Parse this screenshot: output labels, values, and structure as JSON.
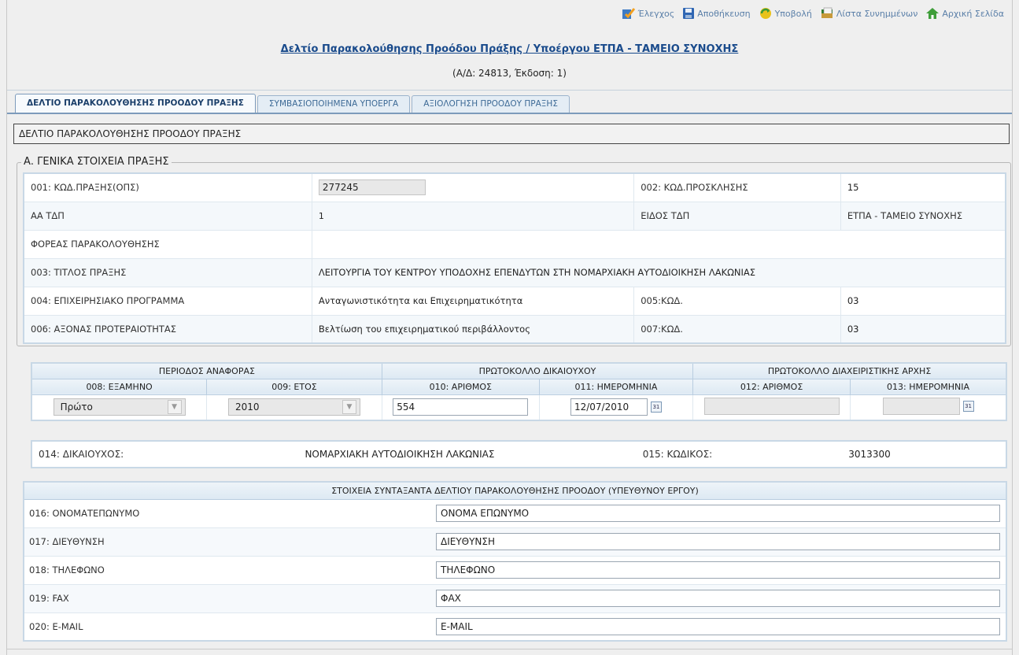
{
  "toolbar": {
    "items": [
      {
        "label": "Έλεγχος",
        "icon": "check-icon"
      },
      {
        "label": "Αποθήκευση",
        "icon": "save-icon"
      },
      {
        "label": "Υποβολή",
        "icon": "submit-icon"
      },
      {
        "label": "Λίστα Συνημμένων",
        "icon": "attachments-icon"
      },
      {
        "label": "Αρχική Σελίδα",
        "icon": "home-icon"
      }
    ]
  },
  "header": {
    "title": "Δελτίο Παρακολούθησης Προόδου Πράξης / Υποέργου ΕΤΠΑ - ΤΑΜΕΙΟ ΣΥΝΟΧΗΣ",
    "subtitle": "(Α/Δ: 24813, Έκδοση: 1)"
  },
  "tabs": [
    {
      "label": "ΔΕΛΤΙΟ ΠΑΡΑΚΟΛΟΥΘΗΣΗΣ ΠΡΟΟΔΟΥ ΠΡΑΞΗΣ",
      "active": true
    },
    {
      "label": "ΣΥΜΒΑΣΙΟΠΟΙΗΜΕΝΑ ΥΠΟΕΡΓΑ",
      "active": false
    },
    {
      "label": "ΑΞΙΟΛΟΓΗΣΗ ΠΡΟΟΔΟΥ ΠΡΑΞΗΣ",
      "active": false
    }
  ],
  "section_banner": "ΔΕΛΤΙΟ ΠΑΡΑΚΟΛΟΥΘΗΣΗΣ ΠΡΟΟΔΟΥ ΠΡΑΞΗΣ",
  "general": {
    "legend": "Α. ΓΕΝΙΚΑ ΣΤΟΙΧΕΙΑ ΠΡΑΞΗΣ",
    "code_label": "001: ΚΩΔ.ΠΡΑΞΗΣ(ΟΠΣ)",
    "code_value": "277245",
    "call_code_label": "002: ΚΩΔ.ΠΡΟΣΚΛΗΣΗΣ",
    "call_code_value": "15",
    "aa_tdp_label": "ΑΑ ΤΔΠ",
    "aa_tdp_value": "1",
    "tdp_type_label": "ΕΙΔΟΣ ΤΔΠ",
    "tdp_type_value": "ΕΤΠΑ - ΤΑΜΕΙΟ ΣΥΝΟΧΗΣ",
    "monitoring_body_label": "ΦΟΡΕΑΣ ΠΑΡΑΚΟΛΟΥΘΗΣΗΣ",
    "monitoring_body_value": "",
    "title_label": "003: ΤΙΤΛΟΣ ΠΡΑΞΗΣ",
    "title_value": "ΛΕΙΤΟΥΡΓΙΑ ΤΟΥ ΚΕΝΤΡΟΥ ΥΠΟΔΟΧΗΣ ΕΠΕΝΔΥΤΩΝ ΣΤΗ ΝΟΜΑΡΧΙΑΚΗ ΑΥΤΟΔΙΟΙΚΗΣΗ ΛΑΚΩΝΙΑΣ",
    "op_label": "004: ΕΠΙΧΕΙΡΗΣΙΑΚΟ ΠΡΟΓΡΑΜΜΑ",
    "op_value": "Ανταγωνιστικότητα και Επιχειρηματικότητα",
    "op_code_label": "005:ΚΩΔ.",
    "op_code_value": "03",
    "axis_label": "006: ΑΞΟΝΑΣ ΠΡΟΤΕΡΑΙΟΤΗΤΑΣ",
    "axis_value": "Βελτίωση του επιχειρηματικού περιβάλλοντος",
    "axis_code_label": "007:ΚΩΔ.",
    "axis_code_value": "03"
  },
  "period": {
    "group_report": "ΠΕΡΙΟΔΟΣ ΑΝΑΦΟΡΑΣ",
    "group_beneficiary": "ΠΡΩΤΟΚΟΛΛΟ ΔΙΚΑΙΟΥΧΟΥ",
    "group_authority": "ΠΡΩΤΟΚΟΛΛΟ ΔΙΑΧΕΙΡΙΣΤΙΚΗΣ ΑΡΧΗΣ",
    "col_semester": "008: ΕΞΑΜΗΝΟ",
    "col_year": "009: ΕΤΟΣ",
    "col_number": "010: ΑΡΙΘΜΟΣ",
    "col_date": "011: ΗΜΕΡΟΜΗΝΙΑ",
    "col_auth_number": "012: ΑΡΙΘΜΟΣ",
    "col_auth_date": "013: ΗΜΕΡΟΜΗΝΙΑ",
    "semester_value": "Πρώτο",
    "year_value": "2010",
    "number_value": "554",
    "date_value": "12/07/2010",
    "auth_number_value": "",
    "auth_date_value": "",
    "calendar_glyph": "31"
  },
  "beneficiary": {
    "label": "014: ΔΙΚΑΙΟΥΧΟΣ:",
    "value": "ΝΟΜΑΡΧΙΑΚΗ ΑΥΤΟΔΙΟΙΚΗΣΗ ΛΑΚΩΝΙΑΣ",
    "code_label": "015: ΚΩΔΙΚΟΣ:",
    "code_value": "3013300"
  },
  "contact": {
    "header": "ΣΤΟΙΧΕΙΑ ΣΥΝΤΑΞΑΝΤΑ ΔΕΛΤΙΟΥ ΠΑΡΑΚΟΛΟΥΘΗΣΗΣ ΠΡΟΟΔΟΥ (ΥΠΕΥΘΥΝΟΥ ΕΡΓΟΥ)",
    "rows": [
      {
        "label": "016: ΟΝΟΜΑΤΕΠΩΝΥΜΟ",
        "value": "ΟΝΟΜΑ ΕΠΩΝΥΜΟ"
      },
      {
        "label": "017: ΔΙΕΥΘΥΝΣΗ",
        "value": "ΔΙΕΥΘΥΝΣΗ"
      },
      {
        "label": "018: ΤΗΛΕΦΩΝΟ",
        "value": "ΤΗΛΕΦΩΝΟ"
      },
      {
        "label": "019: FAX",
        "value": "ΦΑΧ"
      },
      {
        "label": "020: E-MAIL",
        "value": "E-MAIL"
      }
    ]
  },
  "colors": {
    "link": "#1a4b8c",
    "tab_border": "#7d9bbb",
    "table_border": "#c8d8e6"
  }
}
